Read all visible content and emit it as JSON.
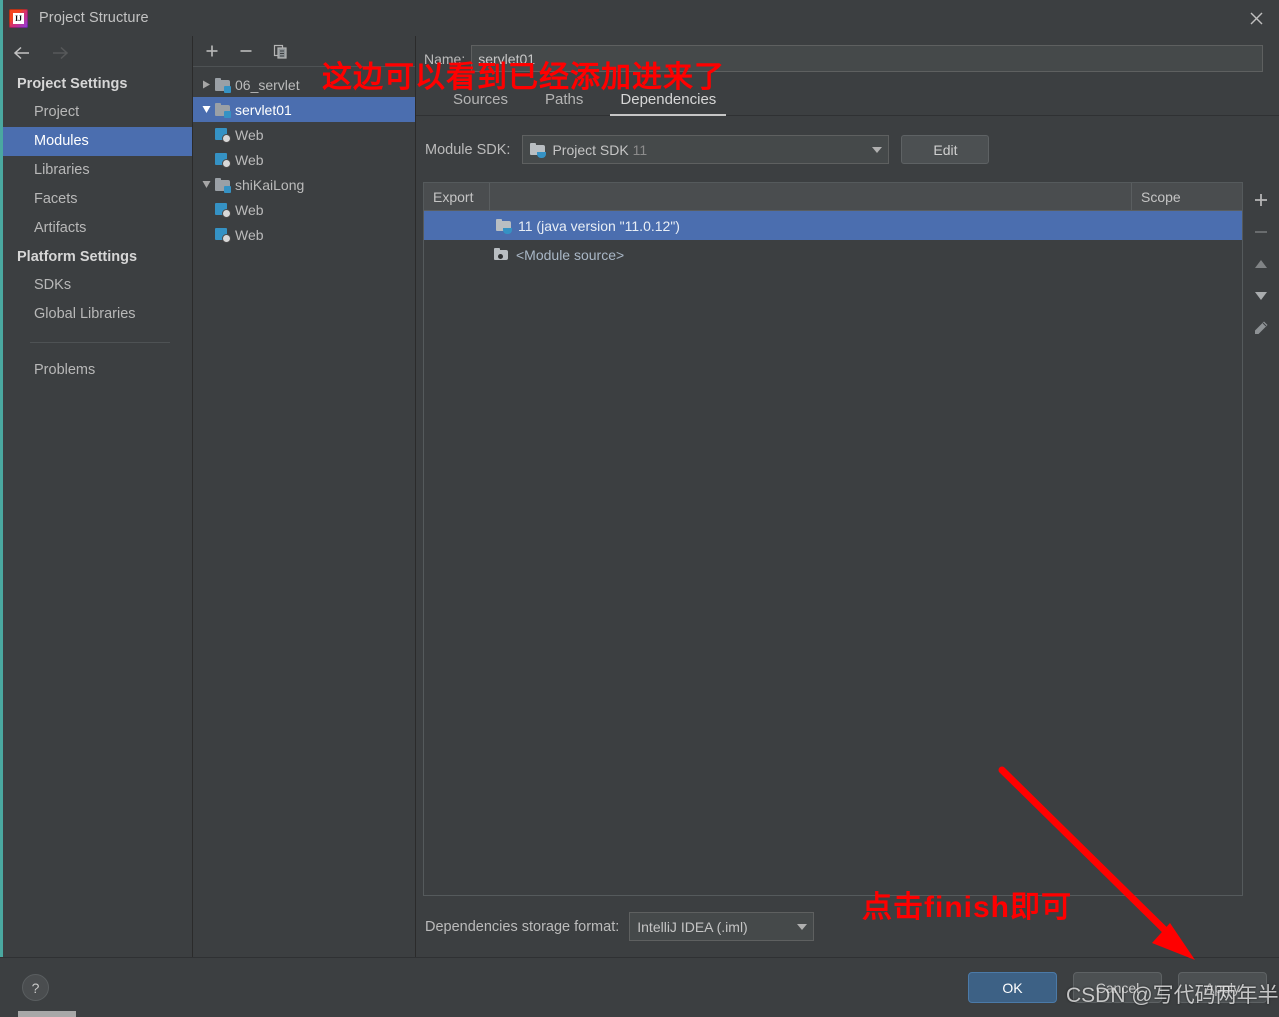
{
  "window": {
    "title": "Project Structure",
    "app_icon": "intellij-idea-logo",
    "close_icon": "close-icon"
  },
  "sidebar": {
    "back_icon": "arrow-left-icon",
    "forward_icon": "arrow-right-icon",
    "sections": [
      {
        "heading": "Project Settings",
        "items": [
          {
            "label": "Project",
            "selected": false
          },
          {
            "label": "Modules",
            "selected": true
          },
          {
            "label": "Libraries",
            "selected": false
          },
          {
            "label": "Facets",
            "selected": false
          },
          {
            "label": "Artifacts",
            "selected": false
          }
        ]
      },
      {
        "heading": "Platform Settings",
        "items": [
          {
            "label": "SDKs",
            "selected": false
          },
          {
            "label": "Global Libraries",
            "selected": false
          }
        ]
      }
    ],
    "problems_label": "Problems"
  },
  "tree_toolbar": {
    "add_icon": "plus-icon",
    "remove_icon": "minus-icon",
    "copy_icon": "copy-icon"
  },
  "module_tree": [
    {
      "label": "06_servlet",
      "icon": "module-icon",
      "expanded": false,
      "level": 0,
      "selected": false,
      "twisty": "collapsed"
    },
    {
      "label": "servlet01",
      "icon": "module-icon",
      "expanded": true,
      "level": 0,
      "selected": true,
      "twisty": "expanded"
    },
    {
      "label": "Web",
      "icon": "web-facet-icon",
      "level": 1,
      "selected": false,
      "twisty": "none"
    },
    {
      "label": "Web",
      "icon": "web-facet-icon",
      "level": 1,
      "selected": false,
      "twisty": "none"
    },
    {
      "label": "shiKaiLong",
      "icon": "module-icon",
      "expanded": true,
      "level": 0,
      "selected": false,
      "twisty": "expanded"
    },
    {
      "label": "Web",
      "icon": "web-facet-icon",
      "level": 1,
      "selected": false,
      "twisty": "none"
    },
    {
      "label": "Web",
      "icon": "web-facet-icon",
      "level": 1,
      "selected": false,
      "twisty": "none"
    }
  ],
  "detail": {
    "name_label": "Name:",
    "name_value": "servlet01",
    "name_placeholder": "",
    "tabs": [
      {
        "label": "Sources",
        "active": false
      },
      {
        "label": "Paths",
        "active": false
      },
      {
        "label": "Dependencies",
        "active": true
      }
    ],
    "module_sdk": {
      "label": "Module SDK:",
      "value_main": "Project SDK",
      "value_dim": "11",
      "icon": "sdk-folder-icon",
      "dropdown_icon": "chevron-down-icon",
      "edit_label": "Edit"
    },
    "table": {
      "columns": {
        "export": "Export",
        "scope": "Scope"
      },
      "rows": [
        {
          "label": "11 (java version \"11.0.12\")",
          "icon": "sdk-folder-icon",
          "selected": true,
          "scope": ""
        },
        {
          "label": "<Module source>",
          "icon": "module-source-icon",
          "selected": false,
          "scope": ""
        }
      ]
    },
    "side_tools": {
      "add_icon": "plus-icon",
      "remove_icon": "minus-icon",
      "up_icon": "triangle-up-icon",
      "down_icon": "triangle-down-icon",
      "edit_icon": "pencil-icon"
    },
    "storage": {
      "label": "Dependencies storage format:",
      "value": "IntelliJ IDEA (.iml)",
      "dropdown_icon": "chevron-down-icon"
    }
  },
  "footer": {
    "help_label": "?",
    "buttons": [
      {
        "label": "OK",
        "primary": true
      },
      {
        "label": "Cancel",
        "primary": false
      },
      {
        "label": "Apply",
        "primary": false
      }
    ]
  },
  "annotations": {
    "top_note": "这边可以看到已经添加进来了",
    "finish_note": "点击finish即可",
    "arrow_icon": "red-arrow-icon",
    "watermark": "CSDN @写代码两年半",
    "color": "#ff0000"
  }
}
